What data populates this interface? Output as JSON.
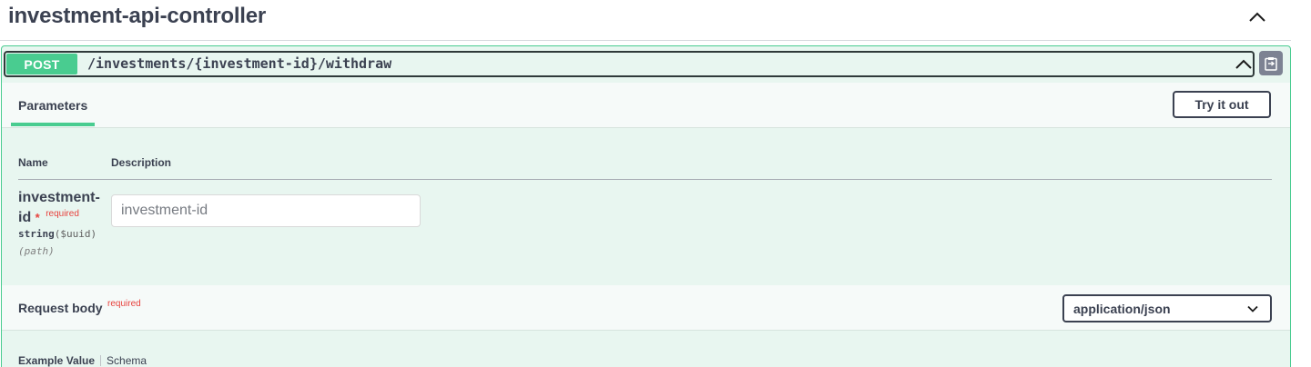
{
  "tag": {
    "title": "investment-api-controller",
    "toggle_icon": "chevron-up-icon"
  },
  "operation": {
    "method": "POST",
    "path": "/investments/{investment-id}/withdraw",
    "method_color": "#49cc90",
    "copy_icon": "clipboard-icon",
    "collapse_icon": "chevron-up-icon"
  },
  "parameters": {
    "tab_label": "Parameters",
    "try_it_out_label": "Try it out",
    "col_name": "Name",
    "col_description": "Description",
    "items": [
      {
        "name": "investment-id",
        "required_star": "*",
        "required_label": "required",
        "type": "string",
        "format": "($uuid)",
        "location": "(path)",
        "placeholder": "investment-id"
      }
    ]
  },
  "request_body": {
    "title": "Request body",
    "required_label": "required",
    "content_type": "application/json",
    "example_tab": "Example Value",
    "schema_tab": "Schema"
  },
  "colors": {
    "accent_green": "#49cc90",
    "background_green": "#e8f6f0",
    "required_red": "#e7423d",
    "text": "#3b4151"
  }
}
